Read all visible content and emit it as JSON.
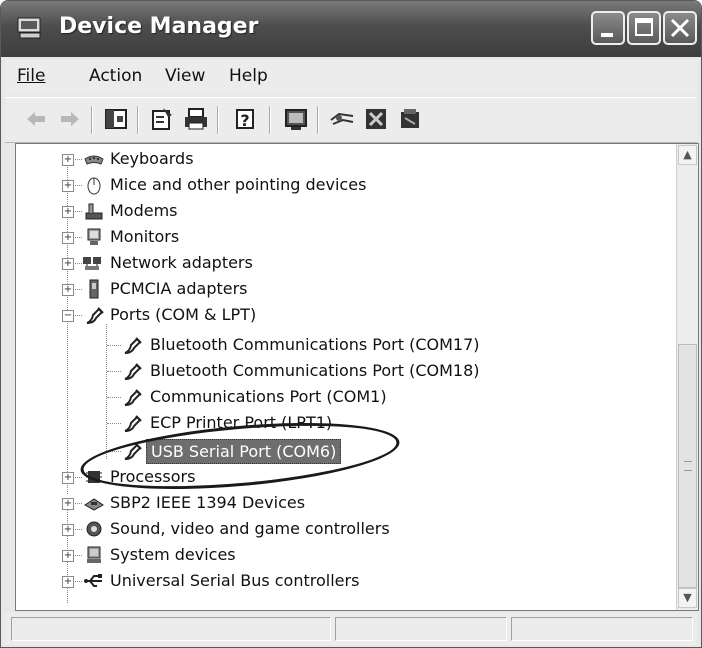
{
  "window": {
    "title": "Device Manager",
    "title_icon": "computer-icon"
  },
  "menu": {
    "file": "File",
    "action": "Action",
    "view": "View",
    "help": "Help"
  },
  "toolbar": {
    "buttons": [
      "back-arrow-icon",
      "forward-arrow-icon",
      "show-hide-console-tree-icon",
      "properties-icon",
      "print-icon",
      "help-icon",
      "computer-icon",
      "scan-hardware-icon",
      "disable-device-icon",
      "uninstall-device-icon"
    ]
  },
  "tree": {
    "categories": [
      {
        "label": "Keyboards",
        "icon": "keyboard-icon",
        "expanded": false
      },
      {
        "label": "Mice and other pointing devices",
        "icon": "mouse-icon",
        "expanded": false
      },
      {
        "label": "Modems",
        "icon": "modem-icon",
        "expanded": false
      },
      {
        "label": "Monitors",
        "icon": "monitor-icon",
        "expanded": false
      },
      {
        "label": "Network adapters",
        "icon": "network-icon",
        "expanded": false
      },
      {
        "label": "PCMCIA adapters",
        "icon": "pcmcia-icon",
        "expanded": false
      },
      {
        "label": "Ports (COM & LPT)",
        "icon": "port-icon",
        "expanded": true
      },
      {
        "label": "Processors",
        "icon": "processor-icon",
        "expanded": false
      },
      {
        "label": "SBP2 IEEE 1394 Devices",
        "icon": "ieee1394-icon",
        "expanded": false
      },
      {
        "label": "Sound, video and game controllers",
        "icon": "sound-icon",
        "expanded": false
      },
      {
        "label": "System devices",
        "icon": "system-icon",
        "expanded": false
      },
      {
        "label": "Universal Serial Bus controllers",
        "icon": "usb-icon",
        "expanded": false
      }
    ],
    "ports": [
      {
        "label": "Bluetooth Communications Port (COM17)"
      },
      {
        "label": "Bluetooth Communications Port (COM18)"
      },
      {
        "label": "Communications Port (COM1)"
      },
      {
        "label": "ECP Printer Port (LPT1)"
      },
      {
        "label": "USB Serial Port (COM6)",
        "selected": true
      }
    ]
  },
  "colors": {
    "selection": "#6e6e6e",
    "title_bar": "#4d4d4d"
  }
}
